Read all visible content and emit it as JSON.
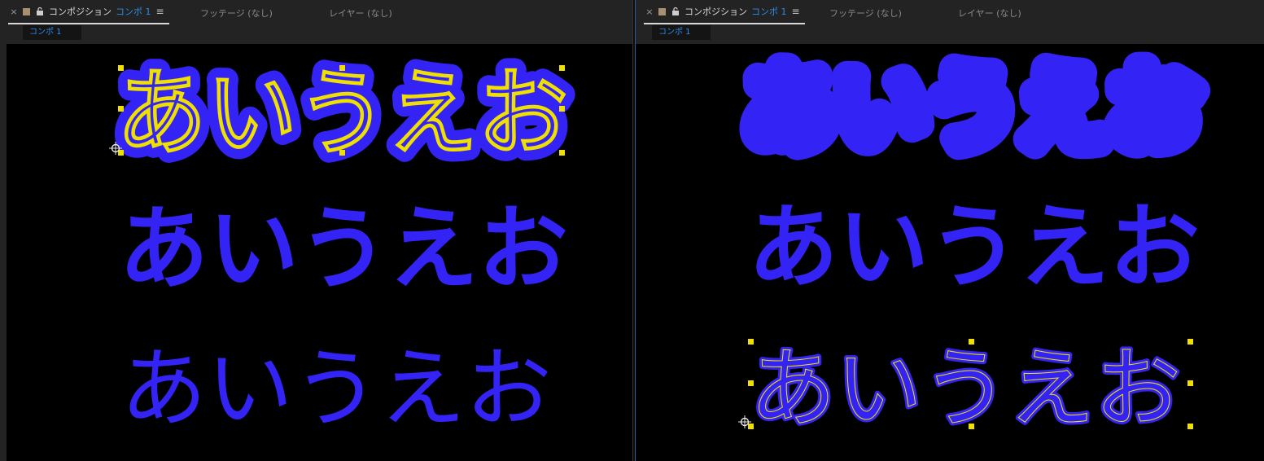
{
  "colors": {
    "text_blue": "#3423f5",
    "accent_blue": "#2d8ceb",
    "handle_yellow": "#f0e000"
  },
  "panels": [
    {
      "tab_close": "×",
      "tab_title": "コンポジション",
      "tab_comp": "コンポ 1",
      "tab_menu": "≡",
      "footage_tab": "フッテージ (なし)",
      "layer_tab": "レイヤー (なし)",
      "comp_chip": "コンポ 1",
      "rows": [
        "あいうえお",
        "あいうえお",
        "あいうえお"
      ]
    },
    {
      "tab_close": "×",
      "tab_title": "コンポジション",
      "tab_comp": "コンポ 1",
      "tab_menu": "≡",
      "footage_tab": "フッテージ (なし)",
      "layer_tab": "レイヤー (なし)",
      "comp_chip": "コンポ 1",
      "rows": [
        "あいうえお",
        "あいうえお",
        "あいうえお"
      ]
    }
  ]
}
